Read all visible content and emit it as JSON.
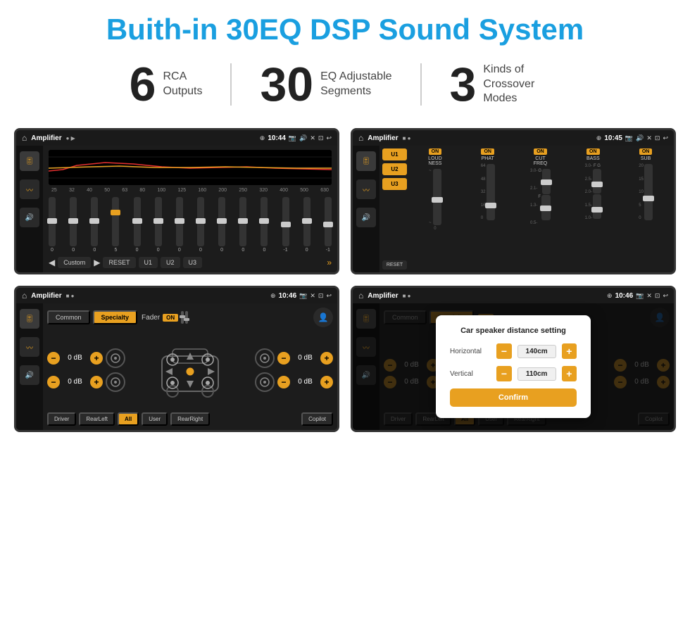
{
  "page": {
    "title": "Buith-in 30EQ DSP Sound System",
    "stats": [
      {
        "number": "6",
        "label": "RCA\nOutputs"
      },
      {
        "number": "30",
        "label": "EQ Adjustable\nSegments"
      },
      {
        "number": "3",
        "label": "Kinds of\nCrossover Modes"
      }
    ]
  },
  "screen_tl": {
    "app_title": "Amplifier",
    "time": "10:44",
    "freq_labels": [
      "25",
      "32",
      "40",
      "50",
      "63",
      "80",
      "100",
      "125",
      "160",
      "200",
      "250",
      "320",
      "400",
      "500",
      "630"
    ],
    "slider_values": [
      "0",
      "0",
      "0",
      "5",
      "0",
      "0",
      "0",
      "0",
      "0",
      "0",
      "0",
      "-1",
      "0",
      "-1"
    ],
    "buttons": [
      "Custom",
      "RESET",
      "U1",
      "U2",
      "U3"
    ]
  },
  "screen_tr": {
    "app_title": "Amplifier",
    "time": "10:45",
    "presets": [
      "U1",
      "U2",
      "U3"
    ],
    "channels": [
      {
        "on": true,
        "label": "LOUDNESS"
      },
      {
        "on": true,
        "label": "PHAT"
      },
      {
        "on": true,
        "label": "CUT FREQ"
      },
      {
        "on": true,
        "label": "BASS"
      },
      {
        "on": true,
        "label": "SUB"
      }
    ],
    "reset_label": "RESET"
  },
  "screen_bl": {
    "app_title": "Amplifier",
    "time": "10:46",
    "tabs": [
      "Common",
      "Specialty"
    ],
    "active_tab": "Specialty",
    "fader_label": "Fader",
    "fader_on": "ON",
    "db_rows": [
      {
        "value": "0 dB"
      },
      {
        "value": "0 dB"
      },
      {
        "value": "0 dB"
      },
      {
        "value": "0 dB"
      }
    ],
    "bottom_buttons": [
      "Driver",
      "RearLeft",
      "All",
      "User",
      "RearRight",
      "Copilot"
    ]
  },
  "screen_br": {
    "app_title": "Amplifier",
    "time": "10:46",
    "tabs": [
      "Common",
      "Specialty"
    ],
    "dialog": {
      "title": "Car speaker distance setting",
      "horizontal_label": "Horizontal",
      "horizontal_value": "140cm",
      "vertical_label": "Vertical",
      "vertical_value": "110cm",
      "confirm_label": "Confirm"
    },
    "bottom_buttons": [
      "Driver",
      "RearLeft",
      "All",
      "User",
      "RearRight",
      "Copilot"
    ]
  }
}
